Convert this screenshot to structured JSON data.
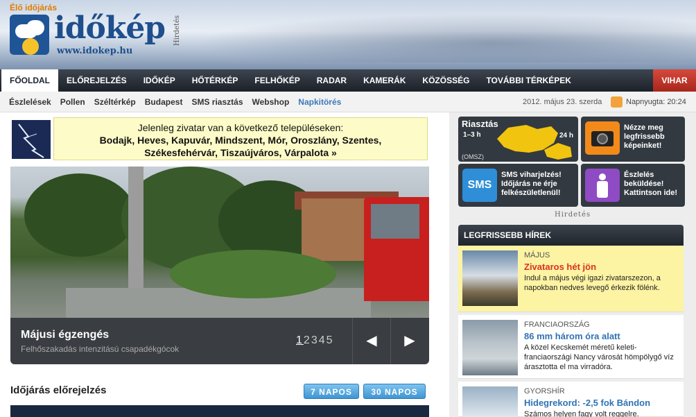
{
  "header": {
    "live_label": "Élő időjárás",
    "logo_text": "időkép",
    "logo_url": "www.idokep.hu",
    "ad_label": "Hirdetés"
  },
  "mainnav": {
    "items": [
      "FŐOLDAL",
      "ELŐREJELZÉS",
      "IDŐKÉP",
      "HŐTÉRKÉP",
      "FELHŐKÉP",
      "RADAR",
      "KAMERÁK",
      "KÖZÖSSÉG",
      "TOVÁBBI TÉRKÉPEK"
    ],
    "vihar": "VIHAR",
    "active_color": "#ffffff",
    "vihar_color": "#c0392b"
  },
  "subnav": {
    "items": [
      "Észlelések",
      "Pollen",
      "Széltérkép",
      "Budapest",
      "SMS riasztás",
      "Webshop",
      "Napkitörés"
    ],
    "date": "2012. május 23. szerda",
    "sunset": "Napnyugta: 20:24"
  },
  "alert": {
    "line1": "Jelenleg zivatar van a következő településeken:",
    "line2": "Bodajk, Heves, Kapuvár, Mindszent, Mór, Oroszlány, Szentes, Székesfehérvár, Tiszaújváros, Várpalota »"
  },
  "slider": {
    "title": "Májusi égzengés",
    "subtitle": "Felhőszakadás intenzitású csapadékgócok",
    "pages": [
      "1",
      "2",
      "3",
      "4",
      "5"
    ],
    "current_page": "1",
    "prev": "◀",
    "next": "▶"
  },
  "forecast": {
    "title": "Időjárás előrejelzés",
    "btn7": "7 NAPOS",
    "btn30": "30 NAPOS"
  },
  "tiles": {
    "riasztas": {
      "title": "Riasztás",
      "h1": "1–3 h",
      "h2": "24 h",
      "source": "(OMSZ)"
    },
    "camera": "Nézze meg legfrissebb képeinket!",
    "sms": {
      "icon_text": "SMS",
      "text": "SMS viharjelzés! Időjárás ne érje felkészületlenül!"
    },
    "eszleles": "Észlelés beküldése! Kattintson ide!",
    "ad_label": "Hirdetés"
  },
  "news": {
    "heading": "LEGFRISSEBB HÍREK",
    "items": [
      {
        "category": "MÁJUS",
        "title": "Zivataros hét jön",
        "lead": "Indul a május végi igazi zivatarszezon, a napokban nedves levegő érkezik fölénk."
      },
      {
        "category": "FRANCIAORSZÁG",
        "title": "86 mm három óra alatt",
        "lead": "A közel Kecskemét méretű keleti-franciaországi Nancy városát hömpölygő víz árasztotta el ma virradóra."
      },
      {
        "category": "GYORSHÍR",
        "title": "Hidegrekord: -2,5 fok Bándon",
        "lead": "Számos helyen fagy volt reggelre."
      }
    ]
  }
}
